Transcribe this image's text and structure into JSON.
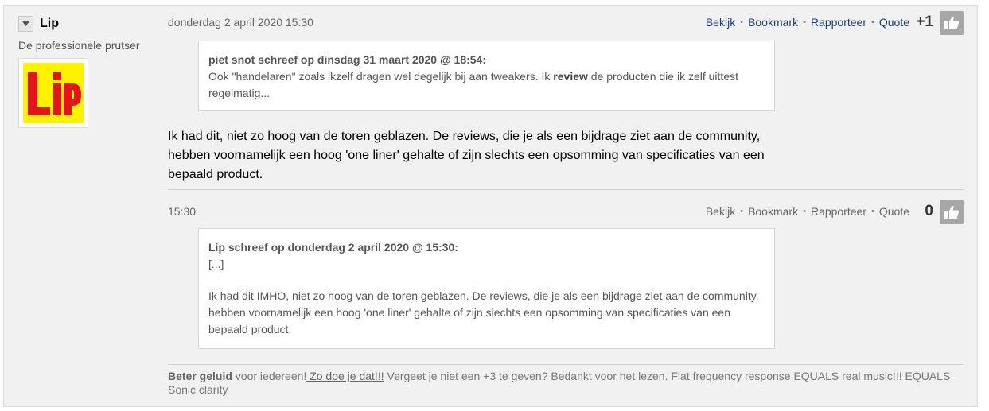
{
  "user": {
    "name": "Lip",
    "title": "De professionele prutser",
    "avatar_text": "Lip",
    "avatar_bg": "#fff200",
    "avatar_fg": "#e3151a",
    "collapse_icon": "triangle-down-icon"
  },
  "post1": {
    "timestamp": "donderdag 2 april 2020 15:30",
    "actions": [
      "Bekijk",
      "Bookmark",
      "Rapporteer",
      "Quote"
    ],
    "separator": "•",
    "score": "+1",
    "like_icon": "thumbs-up-icon",
    "quote": {
      "header": "piet snot schreef op dinsdag 31 maart 2020 @ 18:54:",
      "text_before": "Ook \"handelaren\" zoals ikzelf dragen wel degelijk bij aan tweakers. Ik ",
      "text_bold": "review",
      "text_after": " de producten die ik zelf uittest regelmatig..."
    },
    "body": "Ik had dit, niet zo hoog van de toren geblazen. De reviews, die je als een bijdrage ziet aan de community, hebben voornamelijk een hoog 'one liner' gehalte of zijn slechts een opsomming van specificaties van een bepaald product."
  },
  "post2": {
    "timestamp": "15:30",
    "actions": [
      "Bekijk",
      "Bookmark",
      "Rapporteer",
      "Quote"
    ],
    "separator": "•",
    "score": "0",
    "like_icon": "thumbs-up-icon",
    "quote": {
      "header": "Lip schreef op donderdag 2 april 2020 @ 15:30:",
      "ellipsis": "[...]",
      "text": "Ik had dit IMHO, niet zo hoog van de toren geblazen. De reviews, die je als een bijdrage ziet aan de community, hebben voornamelijk een hoog 'one liner' gehalte of zijn slechts een opsomming van specificaties van een bepaald product."
    }
  },
  "signature": {
    "bold": "Beter geluid",
    "text1": " voor iedereen!",
    "link": " Zo doe je dat!!!",
    "text2": " Vergeet je niet een +3 te geven? Bedankt voor het lezen. Flat frequency response EQUALS real music!!! EQUALS Sonic clarity"
  },
  "colors": {
    "link": "#1f3d78",
    "panel_bg": "#f1f1f1",
    "like_button": "#a7a7a7"
  }
}
